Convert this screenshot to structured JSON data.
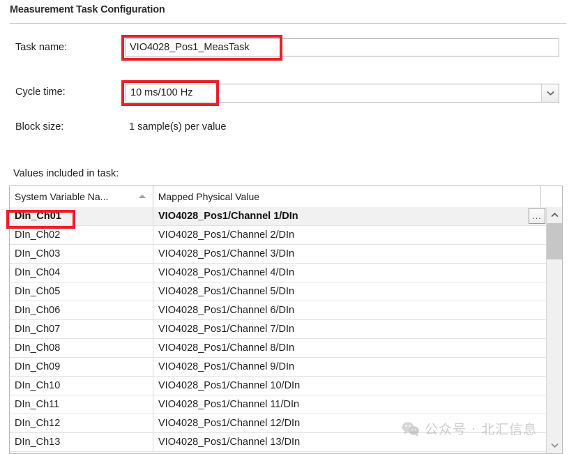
{
  "window": {
    "title": "Measurement Task Configuration"
  },
  "form": {
    "task_name": {
      "label": "Task name:",
      "value": "VIO4028_Pos1_MeasTask",
      "placeholder": ""
    },
    "cycle_time": {
      "label": "Cycle time:",
      "value": "10 ms/100 Hz",
      "dropdown_icon": "chevron-down-icon"
    },
    "block_size": {
      "label": "Block size:",
      "value": "1 sample(s) per value"
    }
  },
  "table": {
    "caption": "Values included in task:",
    "columns": [
      {
        "label": "System Variable Na...",
        "sort": "ascending",
        "sort_icon": "sort-ascending-icon"
      },
      {
        "label": "Mapped Physical Value",
        "sort": "none",
        "sort_icon": ""
      },
      {
        "label": "",
        "sort": "none",
        "sort_icon": ""
      }
    ],
    "selected_row_index": 0,
    "row_action_button": "...",
    "rows": [
      {
        "name": "DIn_Ch01",
        "mapped": "VIO4028_Pos1/Channel 1/DIn"
      },
      {
        "name": "DIn_Ch02",
        "mapped": "VIO4028_Pos1/Channel 2/DIn"
      },
      {
        "name": "DIn_Ch03",
        "mapped": "VIO4028_Pos1/Channel 3/DIn"
      },
      {
        "name": "DIn_Ch04",
        "mapped": "VIO4028_Pos1/Channel 4/DIn"
      },
      {
        "name": "DIn_Ch05",
        "mapped": "VIO4028_Pos1/Channel 5/DIn"
      },
      {
        "name": "DIn_Ch06",
        "mapped": "VIO4028_Pos1/Channel 6/DIn"
      },
      {
        "name": "DIn_Ch07",
        "mapped": "VIO4028_Pos1/Channel 7/DIn"
      },
      {
        "name": "DIn_Ch08",
        "mapped": "VIO4028_Pos1/Channel 8/DIn"
      },
      {
        "name": "DIn_Ch09",
        "mapped": "VIO4028_Pos1/Channel 9/DIn"
      },
      {
        "name": "DIn_Ch10",
        "mapped": "VIO4028_Pos1/Channel 10/DIn"
      },
      {
        "name": "DIn_Ch11",
        "mapped": "VIO4028_Pos1/Channel 11/DIn"
      },
      {
        "name": "DIn_Ch12",
        "mapped": "VIO4028_Pos1/Channel 12/DIn"
      },
      {
        "name": "DIn_Ch13",
        "mapped": "VIO4028_Pos1/Channel 13/DIn"
      }
    ],
    "scrollbar": {
      "up_icon": "chevron-up-icon",
      "down_icon": "chevron-down-icon"
    }
  },
  "annotations": {
    "color": "#e8202a",
    "boxes": [
      {
        "target": "task-name-input"
      },
      {
        "target": "cycle-time-value"
      },
      {
        "target": "first-row-system-variable-name"
      }
    ]
  },
  "watermark": {
    "text": "公众号 · 北汇信息",
    "icon": "wechat-icon",
    "color": "#8d8d8d"
  }
}
